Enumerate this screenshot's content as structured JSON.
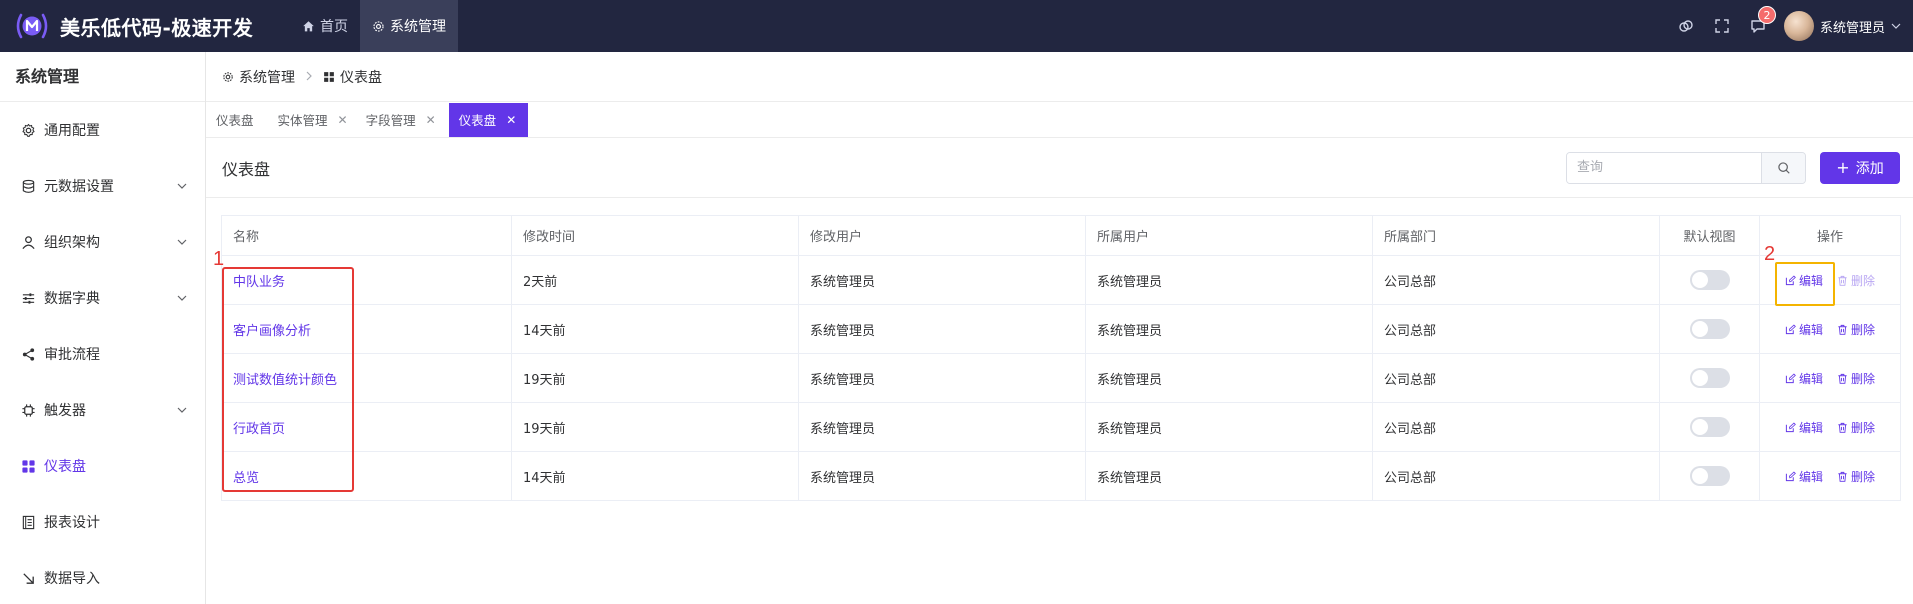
{
  "app": {
    "title": "美乐低代码-极速开发",
    "brand_color": "#6236e8",
    "topbar_color": "#222640"
  },
  "topnav": [
    {
      "label": "首页",
      "icon": "home-icon",
      "active": false
    },
    {
      "label": "系统管理",
      "icon": "gear-icon",
      "active": true
    }
  ],
  "topright": {
    "notification_count": "2",
    "user_name": "系统管理员"
  },
  "sidebar": {
    "title": "系统管理",
    "items": [
      {
        "label": "通用配置",
        "icon": "gear-icon",
        "expandable": false,
        "active": false
      },
      {
        "label": "元数据设置",
        "icon": "database-icon",
        "expandable": true,
        "active": false
      },
      {
        "label": "组织架构",
        "icon": "user-icon",
        "expandable": true,
        "active": false
      },
      {
        "label": "数据字典",
        "icon": "sliders-icon",
        "expandable": true,
        "active": false
      },
      {
        "label": "审批流程",
        "icon": "share-icon",
        "expandable": false,
        "active": false
      },
      {
        "label": "触发器",
        "icon": "chip-icon",
        "expandable": true,
        "active": false
      },
      {
        "label": "仪表盘",
        "icon": "grid-icon",
        "expandable": false,
        "active": true
      },
      {
        "label": "报表设计",
        "icon": "report-icon",
        "expandable": false,
        "active": false
      },
      {
        "label": "数据导入",
        "icon": "import-icon",
        "expandable": false,
        "active": false
      }
    ]
  },
  "breadcrumb": [
    {
      "label": "系统管理",
      "icon": "gear-icon"
    },
    {
      "label": "仪表盘",
      "icon": "grid-icon"
    }
  ],
  "tabs": [
    {
      "label": "仪表盘",
      "closable": false,
      "active": false
    },
    {
      "label": "实体管理",
      "closable": true,
      "active": false
    },
    {
      "label": "字段管理",
      "closable": true,
      "active": false
    },
    {
      "label": "仪表盘",
      "closable": true,
      "active": true
    }
  ],
  "page": {
    "title": "仪表盘",
    "search_placeholder": "查询",
    "add_label": "添加"
  },
  "table": {
    "headers": [
      "名称",
      "修改时间",
      "修改用户",
      "所属用户",
      "所属部门",
      "默认视图",
      "操作"
    ],
    "edit_label": "编辑",
    "delete_label": "删除",
    "rows": [
      {
        "name": "中队业务",
        "modified": "2天前",
        "modified_by": "系统管理员",
        "owner": "系统管理员",
        "dept": "公司总部",
        "default_view": false,
        "delete_disabled": true
      },
      {
        "name": "客户画像分析",
        "modified": "14天前",
        "modified_by": "系统管理员",
        "owner": "系统管理员",
        "dept": "公司总部",
        "default_view": false,
        "delete_disabled": false
      },
      {
        "name": "测试数值统计颜色",
        "modified": "19天前",
        "modified_by": "系统管理员",
        "owner": "系统管理员",
        "dept": "公司总部",
        "default_view": false,
        "delete_disabled": false
      },
      {
        "name": "行政首页",
        "modified": "19天前",
        "modified_by": "系统管理员",
        "owner": "系统管理员",
        "dept": "公司总部",
        "default_view": false,
        "delete_disabled": false
      },
      {
        "name": "总览",
        "modified": "14天前",
        "modified_by": "系统管理员",
        "owner": "系统管理员",
        "dept": "公司总部",
        "default_view": false,
        "delete_disabled": false
      }
    ]
  },
  "annotations": {
    "label_1": "1",
    "label_2": "2"
  }
}
